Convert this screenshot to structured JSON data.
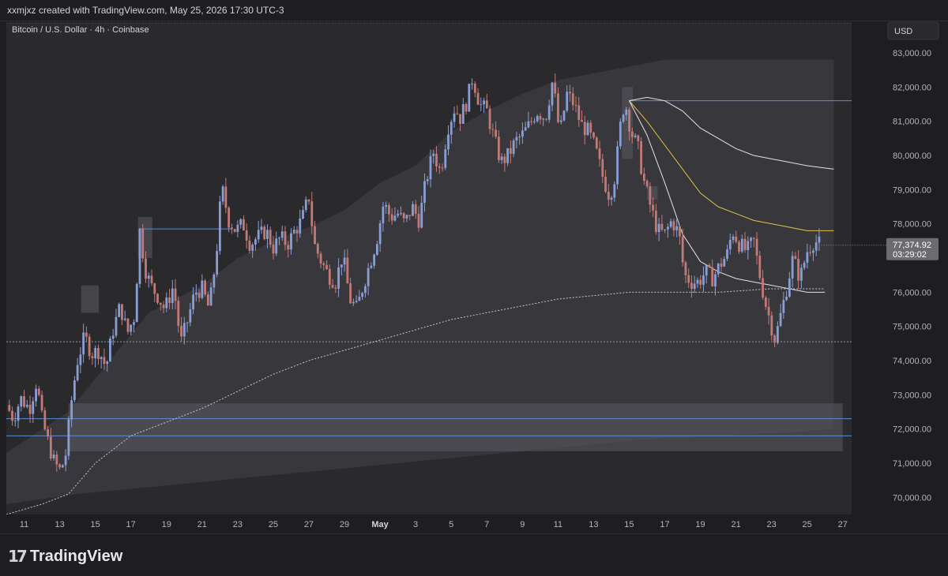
{
  "header": {
    "attribution": "xxmjxz created with TradingView.com, May 25, 2026 17:30 UTC-3"
  },
  "footer": {
    "brand": "TradingView"
  },
  "chart_data": {
    "type": "candlestick",
    "title": "Bitcoin / U.S. Dollar · 4h · Coinbase",
    "currency": "USD",
    "ylim": [
      69500,
      83900
    ],
    "y_ticks": [
      {
        "value": 83000,
        "label": "83,000.00"
      },
      {
        "value": 82000,
        "label": "82,000.00"
      },
      {
        "value": 81000,
        "label": "81,000.00"
      },
      {
        "value": 80000,
        "label": "80,000.00"
      },
      {
        "value": 79000,
        "label": "79,000.00"
      },
      {
        "value": 78000,
        "label": "78,000.00"
      },
      {
        "value": 76000,
        "label": "76,000.00"
      },
      {
        "value": 75000,
        "label": "75,000.00"
      },
      {
        "value": 74000,
        "label": "74,000.00"
      },
      {
        "value": 73000,
        "label": "73,000.00"
      },
      {
        "value": 72000,
        "label": "72,000.00"
      },
      {
        "value": 71000,
        "label": "71,000.00"
      },
      {
        "value": 70000,
        "label": "70,000.00"
      }
    ],
    "x_ticks": [
      {
        "day": 11,
        "label": "11"
      },
      {
        "day": 13,
        "label": "13"
      },
      {
        "day": 15,
        "label": "15"
      },
      {
        "day": 17,
        "label": "17"
      },
      {
        "day": 19,
        "label": "19"
      },
      {
        "day": 21,
        "label": "21"
      },
      {
        "day": 23,
        "label": "23"
      },
      {
        "day": 25,
        "label": "25"
      },
      {
        "day": 27,
        "label": "27"
      },
      {
        "day": 29,
        "label": "29"
      },
      {
        "day": 31,
        "label": "May"
      },
      {
        "day": 33,
        "label": "3"
      },
      {
        "day": 35,
        "label": "5"
      },
      {
        "day": 37,
        "label": "7"
      },
      {
        "day": 39,
        "label": "9"
      },
      {
        "day": 41,
        "label": "11"
      },
      {
        "day": 43,
        "label": "13"
      },
      {
        "day": 45,
        "label": "15"
      },
      {
        "day": 47,
        "label": "17"
      },
      {
        "day": 49,
        "label": "19"
      },
      {
        "day": 51,
        "label": "21"
      },
      {
        "day": 53,
        "label": "23"
      },
      {
        "day": 55,
        "label": "25"
      },
      {
        "day": 57,
        "label": "27"
      }
    ],
    "last_price": {
      "value": 77374.92,
      "label": "77,374.92",
      "countdown": "03:29:02"
    },
    "price_path": [
      [
        10.0,
        72700
      ],
      [
        10.4,
        72300
      ],
      [
        10.8,
        72900
      ],
      [
        11.3,
        72600
      ],
      [
        11.7,
        73400
      ],
      [
        12.0,
        72300
      ],
      [
        12.3,
        71700
      ],
      [
        12.7,
        71000
      ],
      [
        13.0,
        70800
      ],
      [
        13.3,
        71100
      ],
      [
        13.7,
        73000
      ],
      [
        14.0,
        74000
      ],
      [
        14.4,
        74700
      ],
      [
        14.8,
        74200
      ],
      [
        15.2,
        74300
      ],
      [
        15.6,
        73800
      ],
      [
        16.0,
        74900
      ],
      [
        16.4,
        75600
      ],
      [
        16.8,
        74800
      ],
      [
        17.2,
        75300
      ],
      [
        17.5,
        77800
      ],
      [
        17.8,
        76700
      ],
      [
        18.1,
        76200
      ],
      [
        18.5,
        75900
      ],
      [
        18.9,
        75500
      ],
      [
        19.4,
        76200
      ],
      [
        19.8,
        74500
      ],
      [
        20.2,
        75200
      ],
      [
        20.6,
        76000
      ],
      [
        21.0,
        76100
      ],
      [
        21.4,
        75500
      ],
      [
        21.8,
        77100
      ],
      [
        22.1,
        79100
      ],
      [
        22.5,
        78100
      ],
      [
        22.9,
        77800
      ],
      [
        23.3,
        78000
      ],
      [
        23.7,
        77400
      ],
      [
        24.1,
        77600
      ],
      [
        24.6,
        77800
      ],
      [
        25.0,
        77300
      ],
      [
        25.4,
        77600
      ],
      [
        25.8,
        77400
      ],
      [
        26.2,
        77800
      ],
      [
        26.6,
        78100
      ],
      [
        27.0,
        78800
      ],
      [
        27.3,
        77400
      ],
      [
        27.7,
        76900
      ],
      [
        28.1,
        76500
      ],
      [
        28.5,
        76300
      ],
      [
        28.9,
        77100
      ],
      [
        29.3,
        75800
      ],
      [
        29.7,
        75500
      ],
      [
        30.0,
        76100
      ],
      [
        30.4,
        76800
      ],
      [
        30.8,
        77500
      ],
      [
        31.2,
        78600
      ],
      [
        31.6,
        78200
      ],
      [
        32.0,
        78300
      ],
      [
        32.4,
        78000
      ],
      [
        32.8,
        78500
      ],
      [
        33.2,
        78100
      ],
      [
        33.6,
        79300
      ],
      [
        34.0,
        80100
      ],
      [
        34.4,
        79500
      ],
      [
        34.8,
        80800
      ],
      [
        35.2,
        81400
      ],
      [
        35.5,
        81100
      ],
      [
        35.9,
        81600
      ],
      [
        36.2,
        82300
      ],
      [
        36.6,
        81500
      ],
      [
        37.0,
        81300
      ],
      [
        37.4,
        80500
      ],
      [
        37.8,
        79800
      ],
      [
        38.2,
        80000
      ],
      [
        38.6,
        80400
      ],
      [
        39.0,
        80600
      ],
      [
        39.4,
        80900
      ],
      [
        39.8,
        81300
      ],
      [
        40.3,
        81100
      ],
      [
        40.7,
        82200
      ],
      [
        41.1,
        80600
      ],
      [
        41.5,
        81800
      ],
      [
        41.9,
        81500
      ],
      [
        42.3,
        80900
      ],
      [
        42.7,
        80700
      ],
      [
        43.1,
        80200
      ],
      [
        43.5,
        79400
      ],
      [
        43.9,
        78800
      ],
      [
        44.2,
        79400
      ],
      [
        44.6,
        81300
      ],
      [
        44.8,
        81500
      ],
      [
        45.1,
        80700
      ],
      [
        45.5,
        80200
      ],
      [
        45.8,
        79300
      ],
      [
        46.2,
        78500
      ],
      [
        46.6,
        77800
      ],
      [
        47.0,
        77700
      ],
      [
        47.4,
        78100
      ],
      [
        47.8,
        77700
      ],
      [
        48.1,
        76500
      ],
      [
        48.5,
        76300
      ],
      [
        48.9,
        76300
      ],
      [
        49.3,
        76600
      ],
      [
        49.7,
        76400
      ],
      [
        50.1,
        76800
      ],
      [
        50.5,
        77100
      ],
      [
        50.8,
        77800
      ],
      [
        51.2,
        77400
      ],
      [
        51.6,
        77200
      ],
      [
        52.0,
        77500
      ],
      [
        52.3,
        76600
      ],
      [
        52.6,
        75800
      ],
      [
        52.9,
        75200
      ],
      [
        53.2,
        74600
      ],
      [
        53.5,
        75300
      ],
      [
        53.8,
        76000
      ],
      [
        54.2,
        77000
      ],
      [
        54.6,
        76400
      ],
      [
        55.0,
        77200
      ],
      [
        55.4,
        77500
      ],
      [
        55.8,
        77370
      ]
    ],
    "levels": [
      {
        "kind": "dotted",
        "price": 74550,
        "color": "#9598a1"
      },
      {
        "kind": "solid",
        "price": 81600,
        "x_start": 45.0,
        "color": "#5b8dd6"
      },
      {
        "kind": "solid",
        "price": 77850,
        "x_start": 17.5,
        "x_end": 22.7,
        "color": "#5b8dd6"
      },
      {
        "kind": "solid",
        "price": 72300,
        "color": "#5b8dd6"
      },
      {
        "kind": "solid",
        "price": 71800,
        "color": "#5b8dd6"
      },
      {
        "kind": "solid",
        "price": 69300,
        "color": "#5b8dd6"
      }
    ],
    "zones": [
      {
        "x_start": 13.5,
        "x_end": 57.0,
        "y_high": 72750,
        "y_low": 71350,
        "color": "#5a5a60"
      },
      {
        "x_start": 17.4,
        "x_end": 18.2,
        "y_high": 78200,
        "y_low": 77000,
        "color": "#5a5a60"
      },
      {
        "x_start": 14.2,
        "x_end": 15.2,
        "y_high": 76200,
        "y_low": 75400,
        "color": "#5a5a60"
      },
      {
        "x_start": 44.6,
        "x_end": 45.2,
        "y_high": 82000,
        "y_low": 79900,
        "color": "#5a5a60"
      },
      {
        "x_start": 46.0,
        "x_end": 46.6,
        "y_high": 79100,
        "y_low": 78700,
        "color": "#5a5a60"
      }
    ],
    "band": {
      "color": "#3a3a3e",
      "upper": [
        [
          10.0,
          71300
        ],
        [
          13.5,
          72500
        ],
        [
          15.5,
          73800
        ],
        [
          18.0,
          75400
        ],
        [
          21.0,
          76200
        ],
        [
          23.0,
          77000
        ],
        [
          25.0,
          77500
        ],
        [
          27.0,
          77900
        ],
        [
          29.0,
          78400
        ],
        [
          31.0,
          79200
        ],
        [
          33.0,
          79700
        ],
        [
          35.0,
          80700
        ],
        [
          37.0,
          81300
        ],
        [
          39.0,
          81800
        ],
        [
          41.0,
          82200
        ],
        [
          43.0,
          82400
        ],
        [
          45.0,
          82600
        ],
        [
          47.0,
          82800
        ],
        [
          49.0,
          82800
        ],
        [
          51.0,
          82800
        ],
        [
          53.0,
          82800
        ],
        [
          55.0,
          82800
        ],
        [
          56.5,
          82800
        ]
      ],
      "lower": [
        [
          10.0,
          69800
        ],
        [
          14.0,
          70100
        ],
        [
          18.0,
          70300
        ],
        [
          22.0,
          70500
        ],
        [
          26.0,
          70700
        ],
        [
          30.0,
          70900
        ],
        [
          34.0,
          71100
        ],
        [
          38.0,
          71300
        ],
        [
          42.0,
          71500
        ],
        [
          46.0,
          71700
        ],
        [
          50.0,
          71800
        ],
        [
          54.0,
          71900
        ],
        [
          56.5,
          72000
        ]
      ]
    },
    "lines": [
      {
        "name": "",
        "color": "#c8c8cc",
        "dash": "2,2",
        "points": [
          [
            10.0,
            69500
          ],
          [
            12.0,
            69800
          ],
          [
            13.5,
            70100
          ],
          [
            15.0,
            71000
          ],
          [
            17.0,
            71800
          ],
          [
            19.0,
            72200
          ],
          [
            21.0,
            72600
          ],
          [
            23.0,
            73100
          ],
          [
            25.0,
            73600
          ],
          [
            27.0,
            74000
          ],
          [
            29.0,
            74300
          ],
          [
            31.0,
            74600
          ],
          [
            33.0,
            74900
          ],
          [
            35.0,
            75200
          ],
          [
            37.0,
            75400
          ],
          [
            39.0,
            75600
          ],
          [
            41.0,
            75800
          ],
          [
            43.0,
            75900
          ],
          [
            45.0,
            76000
          ],
          [
            47.0,
            76000
          ],
          [
            50.0,
            76000
          ],
          [
            53.0,
            76100
          ],
          [
            56.0,
            76100
          ]
        ]
      },
      {
        "name": "",
        "color": "#e3e3e6",
        "dash": "",
        "points": [
          [
            45.0,
            81600
          ],
          [
            46.0,
            81700
          ],
          [
            47.0,
            81600
          ],
          [
            48.0,
            81300
          ],
          [
            49.0,
            80800
          ],
          [
            50.0,
            80500
          ],
          [
            51.0,
            80200
          ],
          [
            52.0,
            80000
          ],
          [
            53.0,
            79900
          ],
          [
            54.0,
            79800
          ],
          [
            55.0,
            79700
          ],
          [
            56.5,
            79600
          ]
        ]
      },
      {
        "name": "",
        "color": "#e0c04a",
        "dash": "",
        "points": [
          [
            45.0,
            81600
          ],
          [
            46.0,
            81000
          ],
          [
            47.0,
            80300
          ],
          [
            48.0,
            79600
          ],
          [
            49.0,
            78900
          ],
          [
            50.0,
            78500
          ],
          [
            51.0,
            78300
          ],
          [
            52.0,
            78100
          ],
          [
            53.0,
            78000
          ],
          [
            54.0,
            77900
          ],
          [
            55.0,
            77800
          ],
          [
            56.5,
            77800
          ]
        ]
      },
      {
        "name": "",
        "color": "#e3e3e6",
        "dash": "",
        "points": [
          [
            45.0,
            81600
          ],
          [
            46.0,
            80600
          ],
          [
            47.0,
            79200
          ],
          [
            48.0,
            77700
          ],
          [
            49.0,
            76900
          ],
          [
            50.0,
            76600
          ],
          [
            51.0,
            76400
          ],
          [
            52.0,
            76300
          ],
          [
            53.0,
            76200
          ],
          [
            54.0,
            76100
          ],
          [
            55.0,
            76000
          ],
          [
            56.0,
            76000
          ]
        ]
      }
    ],
    "colors": {
      "up": "#8a9ed6",
      "down": "#c27a76",
      "background": "#2a2a2d",
      "grid": "#2f2f33"
    },
    "grid": false,
    "legend": "none"
  }
}
